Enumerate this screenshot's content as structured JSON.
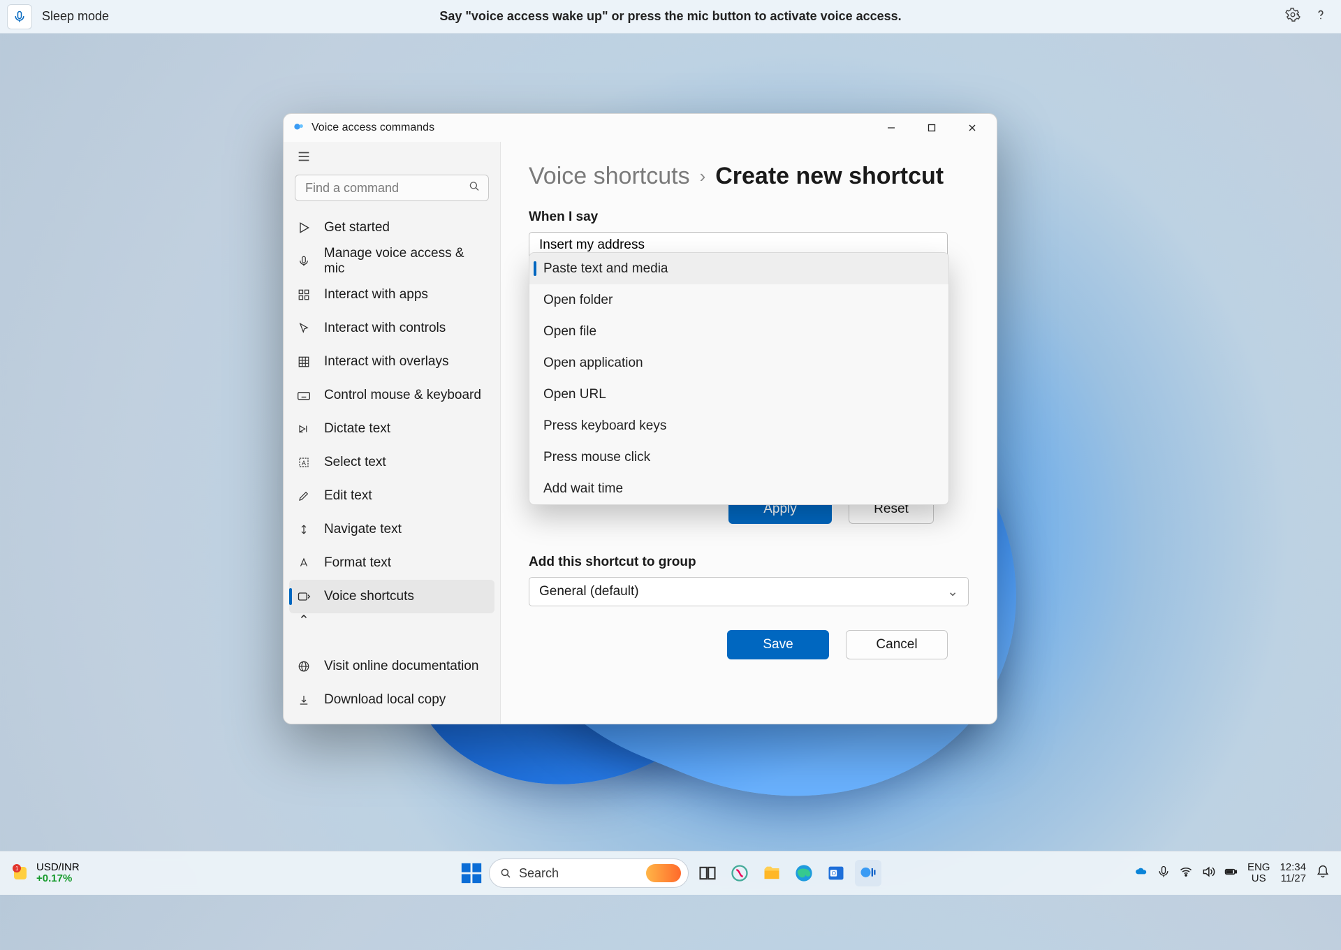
{
  "voice_bar": {
    "mode": "Sleep mode",
    "message": "Say \"voice access wake up\" or press the mic button to activate voice access."
  },
  "window": {
    "title": "Voice access commands",
    "search_placeholder": "Find a command",
    "sidebar": {
      "items": [
        {
          "label": "Get started"
        },
        {
          "label": "Manage voice access & mic"
        },
        {
          "label": "Interact with apps"
        },
        {
          "label": "Interact with controls"
        },
        {
          "label": "Interact with overlays"
        },
        {
          "label": "Control mouse & keyboard"
        },
        {
          "label": "Dictate text"
        },
        {
          "label": "Select text"
        },
        {
          "label": "Edit text"
        },
        {
          "label": "Navigate text"
        },
        {
          "label": "Format text"
        },
        {
          "label": "Voice shortcuts"
        }
      ],
      "bottom": [
        {
          "label": "Visit online documentation"
        },
        {
          "label": "Download local copy"
        }
      ]
    },
    "main": {
      "breadcrumb1": "Voice shortcuts",
      "breadcrumb2": "Create new shortcut",
      "when_label": "When I say",
      "when_value": "Insert my address",
      "dropdown": [
        "Paste text and media",
        "Open folder",
        "Open file",
        "Open application",
        "Open URL",
        "Press keyboard keys",
        "Press mouse click",
        "Add wait time"
      ],
      "apply": "Apply",
      "reset": "Reset",
      "group_label": "Add this shortcut to group",
      "group_value": "General (default)",
      "save": "Save",
      "cancel": "Cancel"
    }
  },
  "taskbar": {
    "stock_pair": "USD/INR",
    "stock_change": "+0.17%",
    "search": "Search",
    "lang1": "ENG",
    "lang2": "US",
    "time": "12:34",
    "date": "11/27"
  }
}
